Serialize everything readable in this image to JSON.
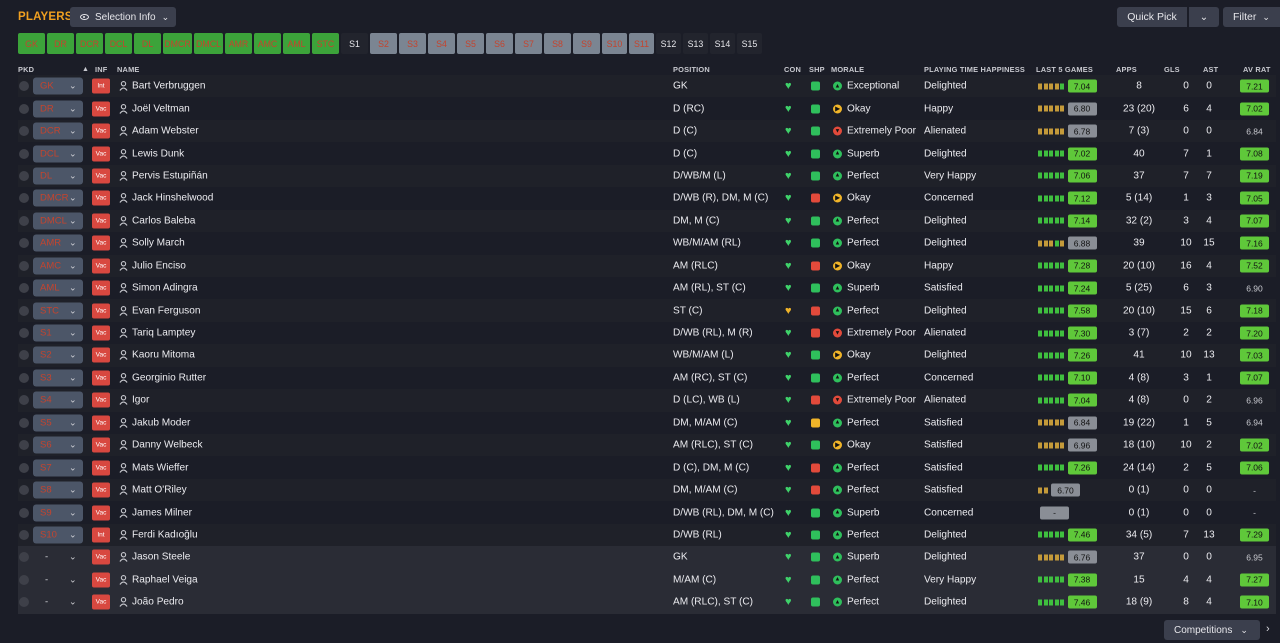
{
  "header": {
    "title": "PLAYERS",
    "selection_info": "Selection Info",
    "quick_pick": "Quick Pick",
    "filter": "Filter"
  },
  "positions": [
    {
      "label": "GK",
      "style": "green"
    },
    {
      "label": "DR",
      "style": "green"
    },
    {
      "label": "DCR",
      "style": "green"
    },
    {
      "label": "DCL",
      "style": "green"
    },
    {
      "label": "DL",
      "style": "green"
    },
    {
      "label": "DMCR",
      "style": "green"
    },
    {
      "label": "DMCL",
      "style": "green"
    },
    {
      "label": "AMR",
      "style": "green"
    },
    {
      "label": "AMC",
      "style": "green"
    },
    {
      "label": "AML",
      "style": "green"
    },
    {
      "label": "STC",
      "style": "green"
    },
    {
      "label": "S1",
      "style": "dark"
    },
    {
      "label": "S2",
      "style": "grey"
    },
    {
      "label": "S3",
      "style": "grey"
    },
    {
      "label": "S4",
      "style": "grey"
    },
    {
      "label": "S5",
      "style": "grey"
    },
    {
      "label": "S6",
      "style": "grey"
    },
    {
      "label": "S7",
      "style": "grey"
    },
    {
      "label": "S8",
      "style": "grey"
    },
    {
      "label": "S9",
      "style": "grey"
    },
    {
      "label": "S10",
      "style": "grey"
    },
    {
      "label": "S11",
      "style": "grey"
    },
    {
      "label": "S12",
      "style": "dark"
    },
    {
      "label": "S13",
      "style": "dark"
    },
    {
      "label": "S14",
      "style": "dark"
    },
    {
      "label": "S15",
      "style": "dark"
    }
  ],
  "columns": {
    "pkd": "PKD",
    "inf": "INF",
    "name": "NAME",
    "position": "POSITION",
    "con": "CON",
    "shp": "SHP",
    "morale": "MORALE",
    "pth": "PLAYING TIME HAPPINESS",
    "last5": "LAST 5 GAMES",
    "apps": "APPS",
    "gls": "GLS",
    "ast": "AST",
    "avr": "AV RAT"
  },
  "players": [
    {
      "pkd": "GK",
      "inf": "Int",
      "name": "Bart Verbruggen",
      "pos": "GK",
      "con": "full",
      "shp": "up",
      "morale": "Exceptional",
      "pth": "Delighted",
      "form": [
        "o",
        "o",
        "o",
        "o",
        "g"
      ],
      "last": "7.04",
      "last_c": "green",
      "apps": "8",
      "gls": "0",
      "ast": "0",
      "avr": "7.21",
      "avr_c": "green"
    },
    {
      "pkd": "DR",
      "inf": "Vac",
      "name": "Joël Veltman",
      "pos": "D (RC)",
      "con": "full",
      "shp": "up",
      "morale": "Okay",
      "pth": "Happy",
      "form": [
        "o",
        "o",
        "o",
        "o",
        "o"
      ],
      "last": "6.80",
      "last_c": "grey",
      "apps": "23 (20)",
      "gls": "6",
      "ast": "4",
      "avr": "7.02",
      "avr_c": "green"
    },
    {
      "pkd": "DCR",
      "inf": "Vac",
      "name": "Adam Webster",
      "pos": "D (C)",
      "con": "full",
      "shp": "up",
      "morale": "Extremely Poor",
      "pth": "Alienated",
      "form": [
        "o",
        "o",
        "o",
        "o",
        "o"
      ],
      "last": "6.78",
      "last_c": "grey",
      "apps": "7 (3)",
      "gls": "0",
      "ast": "0",
      "avr": "6.84",
      "avr_c": "plain"
    },
    {
      "pkd": "DCL",
      "inf": "Vac",
      "name": "Lewis Dunk",
      "pos": "D (C)",
      "con": "full",
      "shp": "down",
      "morale": "Superb",
      "pth": "Delighted",
      "form": [
        "g",
        "g",
        "g",
        "g",
        "g"
      ],
      "last": "7.02",
      "last_c": "green",
      "apps": "40",
      "gls": "7",
      "ast": "1",
      "avr": "7.08",
      "avr_c": "green"
    },
    {
      "pkd": "DL",
      "inf": "Vac",
      "name": "Pervis Estupiñán",
      "pos": "D/WB/M (L)",
      "con": "full",
      "shp": "up",
      "morale": "Perfect",
      "pth": "Very Happy",
      "form": [
        "g",
        "g",
        "g",
        "g",
        "g"
      ],
      "last": "7.06",
      "last_c": "green",
      "apps": "37",
      "gls": "7",
      "ast": "7",
      "avr": "7.19",
      "avr_c": "green"
    },
    {
      "pkd": "DMCR",
      "inf": "Vac",
      "name": "Jack Hinshelwood",
      "pos": "D/WB (R), DM, M (C)",
      "con": "full",
      "shp": "red",
      "morale": "Okay",
      "pth": "Concerned",
      "form": [
        "g",
        "g",
        "g",
        "g",
        "g"
      ],
      "last": "7.12",
      "last_c": "green",
      "apps": "5 (14)",
      "gls": "1",
      "ast": "3",
      "avr": "7.05",
      "avr_c": "green"
    },
    {
      "pkd": "DMCL",
      "inf": "Vac",
      "name": "Carlos Baleba",
      "pos": "DM, M (C)",
      "con": "full",
      "shp": "up",
      "morale": "Perfect",
      "pth": "Delighted",
      "form": [
        "g",
        "g",
        "g",
        "g",
        "g"
      ],
      "last": "7.14",
      "last_c": "green",
      "apps": "32 (2)",
      "gls": "3",
      "ast": "4",
      "avr": "7.07",
      "avr_c": "green"
    },
    {
      "pkd": "AMR",
      "inf": "Vac",
      "name": "Solly March",
      "pos": "WB/M/AM (RL)",
      "con": "full",
      "shp": "up",
      "morale": "Perfect",
      "pth": "Delighted",
      "form": [
        "o",
        "o",
        "o",
        "g",
        "o"
      ],
      "last": "6.88",
      "last_c": "grey",
      "apps": "39",
      "gls": "10",
      "ast": "15",
      "avr": "7.16",
      "avr_c": "green"
    },
    {
      "pkd": "AMC",
      "inf": "Vac",
      "name": "Julio Enciso",
      "pos": "AM (RLC)",
      "con": "full",
      "shp": "red",
      "morale": "Okay",
      "pth": "Happy",
      "form": [
        "g",
        "g",
        "g",
        "g",
        "g"
      ],
      "last": "7.28",
      "last_c": "green",
      "apps": "20 (10)",
      "gls": "16",
      "ast": "4",
      "avr": "7.52",
      "avr_c": "green"
    },
    {
      "pkd": "AML",
      "inf": "Vac",
      "name": "Simon Adingra",
      "pos": "AM (RL), ST (C)",
      "con": "full",
      "shp": "up",
      "morale": "Superb",
      "pth": "Satisfied",
      "form": [
        "g",
        "g",
        "g",
        "g",
        "g"
      ],
      "last": "7.24",
      "last_c": "green",
      "apps": "5 (25)",
      "gls": "6",
      "ast": "3",
      "avr": "6.90",
      "avr_c": "plain"
    },
    {
      "pkd": "STC",
      "inf": "Vac",
      "name": "Evan Ferguson",
      "pos": "ST (C)",
      "con": "yellow",
      "shp": "red",
      "morale": "Perfect",
      "pth": "Delighted",
      "form": [
        "g",
        "g",
        "g",
        "g",
        "g"
      ],
      "last": "7.58",
      "last_c": "green",
      "apps": "20 (10)",
      "gls": "15",
      "ast": "6",
      "avr": "7.18",
      "avr_c": "green"
    },
    {
      "pkd": "S1",
      "inf": "Vac",
      "name": "Tariq Lamptey",
      "pos": "D/WB (RL), M (R)",
      "con": "full",
      "shp": "red",
      "morale": "Extremely Poor",
      "pth": "Alienated",
      "form": [
        "g",
        "g",
        "g",
        "g",
        "g"
      ],
      "last": "7.30",
      "last_c": "green",
      "apps": "3 (7)",
      "gls": "2",
      "ast": "2",
      "avr": "7.20",
      "avr_c": "green"
    },
    {
      "pkd": "S2",
      "inf": "Vac",
      "name": "Kaoru Mitoma",
      "pos": "WB/M/AM (L)",
      "con": "full",
      "shp": "up",
      "morale": "Okay",
      "pth": "Delighted",
      "form": [
        "g",
        "g",
        "g",
        "g",
        "g"
      ],
      "last": "7.26",
      "last_c": "green",
      "apps": "41",
      "gls": "10",
      "ast": "13",
      "avr": "7.03",
      "avr_c": "green"
    },
    {
      "pkd": "S3",
      "inf": "Vac",
      "name": "Georginio Rutter",
      "pos": "AM (RC), ST (C)",
      "con": "full",
      "shp": "up",
      "morale": "Perfect",
      "pth": "Concerned",
      "form": [
        "g",
        "g",
        "g",
        "g",
        "g"
      ],
      "last": "7.10",
      "last_c": "green",
      "apps": "4 (8)",
      "gls": "3",
      "ast": "1",
      "avr": "7.07",
      "avr_c": "green"
    },
    {
      "pkd": "S4",
      "inf": "Vac",
      "name": "Igor",
      "pos": "D (LC), WB (L)",
      "con": "full",
      "shp": "red",
      "morale": "Extremely Poor",
      "pth": "Alienated",
      "form": [
        "g",
        "g",
        "g",
        "g",
        "g"
      ],
      "last": "7.04",
      "last_c": "green",
      "apps": "4 (8)",
      "gls": "0",
      "ast": "2",
      "avr": "6.96",
      "avr_c": "plain"
    },
    {
      "pkd": "S5",
      "inf": "Vac",
      "name": "Jakub Moder",
      "pos": "DM, M/AM (C)",
      "con": "full",
      "shp": "orange",
      "morale": "Perfect",
      "pth": "Satisfied",
      "form": [
        "o",
        "o",
        "o",
        "o",
        "o"
      ],
      "last": "6.84",
      "last_c": "grey",
      "apps": "19 (22)",
      "gls": "1",
      "ast": "5",
      "avr": "6.94",
      "avr_c": "plain"
    },
    {
      "pkd": "S6",
      "inf": "Vac",
      "name": "Danny Welbeck",
      "pos": "AM (RLC), ST (C)",
      "con": "full",
      "shp": "down",
      "morale": "Okay",
      "pth": "Satisfied",
      "form": [
        "o",
        "o",
        "o",
        "o",
        "o"
      ],
      "last": "6.96",
      "last_c": "grey",
      "apps": "18 (10)",
      "gls": "10",
      "ast": "2",
      "avr": "7.02",
      "avr_c": "green"
    },
    {
      "pkd": "S7",
      "inf": "Vac",
      "name": "Mats Wieffer",
      "pos": "D (C), DM, M (C)",
      "con": "full",
      "shp": "red",
      "morale": "Perfect",
      "pth": "Satisfied",
      "form": [
        "g",
        "g",
        "g",
        "g",
        "g"
      ],
      "last": "7.26",
      "last_c": "green",
      "apps": "24 (14)",
      "gls": "2",
      "ast": "5",
      "avr": "7.06",
      "avr_c": "green"
    },
    {
      "pkd": "S8",
      "inf": "Vac",
      "name": "Matt O'Riley",
      "pos": "DM, M/AM (C)",
      "con": "full",
      "shp": "red",
      "morale": "Perfect",
      "pth": "Satisfied",
      "form": [
        "o",
        "o"
      ],
      "last": "6.70",
      "last_c": "grey",
      "apps": "0 (1)",
      "gls": "0",
      "ast": "0",
      "avr": "-",
      "avr_c": "plain"
    },
    {
      "pkd": "S9",
      "inf": "Vac",
      "name": "James Milner",
      "pos": "D/WB (RL), DM, M (C)",
      "con": "full",
      "shp": "up",
      "morale": "Superb",
      "pth": "Concerned",
      "form": [],
      "last": "-",
      "last_c": "grey",
      "apps": "0 (1)",
      "gls": "0",
      "ast": "0",
      "avr": "-",
      "avr_c": "plain"
    },
    {
      "pkd": "S10",
      "inf": "Int",
      "name": "Ferdi Kadıoğlu",
      "pos": "D/WB (RL)",
      "con": "full",
      "shp": "up",
      "morale": "Perfect",
      "pth": "Delighted",
      "form": [
        "g",
        "g",
        "g",
        "g",
        "g"
      ],
      "last": "7.46",
      "last_c": "green",
      "apps": "34 (5)",
      "gls": "7",
      "ast": "13",
      "avr": "7.29",
      "avr_c": "green"
    },
    {
      "pkd": "-",
      "inf": "Vac",
      "name": "Jason Steele",
      "pos": "GK",
      "con": "full",
      "shp": "up",
      "morale": "Superb",
      "pth": "Delighted",
      "form": [
        "o",
        "o",
        "o",
        "o",
        "o"
      ],
      "last": "6.76",
      "last_c": "grey",
      "apps": "37",
      "gls": "0",
      "ast": "0",
      "avr": "6.95",
      "avr_c": "plain"
    },
    {
      "pkd": "-",
      "inf": "Vac",
      "name": "Raphael Veiga",
      "pos": "M/AM (C)",
      "con": "full",
      "shp": "down",
      "morale": "Perfect",
      "pth": "Very Happy",
      "form": [
        "g",
        "g",
        "g",
        "g",
        "g"
      ],
      "last": "7.38",
      "last_c": "green",
      "apps": "15",
      "gls": "4",
      "ast": "4",
      "avr": "7.27",
      "avr_c": "green"
    },
    {
      "pkd": "-",
      "inf": "Vac",
      "name": "João Pedro",
      "pos": "AM (RLC), ST (C)",
      "con": "full",
      "shp": "up",
      "morale": "Perfect",
      "pth": "Delighted",
      "form": [
        "g",
        "g",
        "g",
        "g",
        "g"
      ],
      "last": "7.46",
      "last_c": "green",
      "apps": "18 (9)",
      "gls": "8",
      "ast": "4",
      "avr": "7.10",
      "avr_c": "green"
    }
  ],
  "footer": {
    "competitions": "Competitions"
  },
  "colors": {
    "accent": "#f0a020",
    "green": "#3ca33a",
    "rating_green": "#5fc83a",
    "rating_grey": "#8a8e96",
    "form_orange": "#c49a3a",
    "form_green": "#3fbf3f",
    "inf_red": "#d84840",
    "morale_green": "#2fbf5c",
    "morale_yellow": "#f0b429",
    "morale_red": "#e24a3b"
  }
}
